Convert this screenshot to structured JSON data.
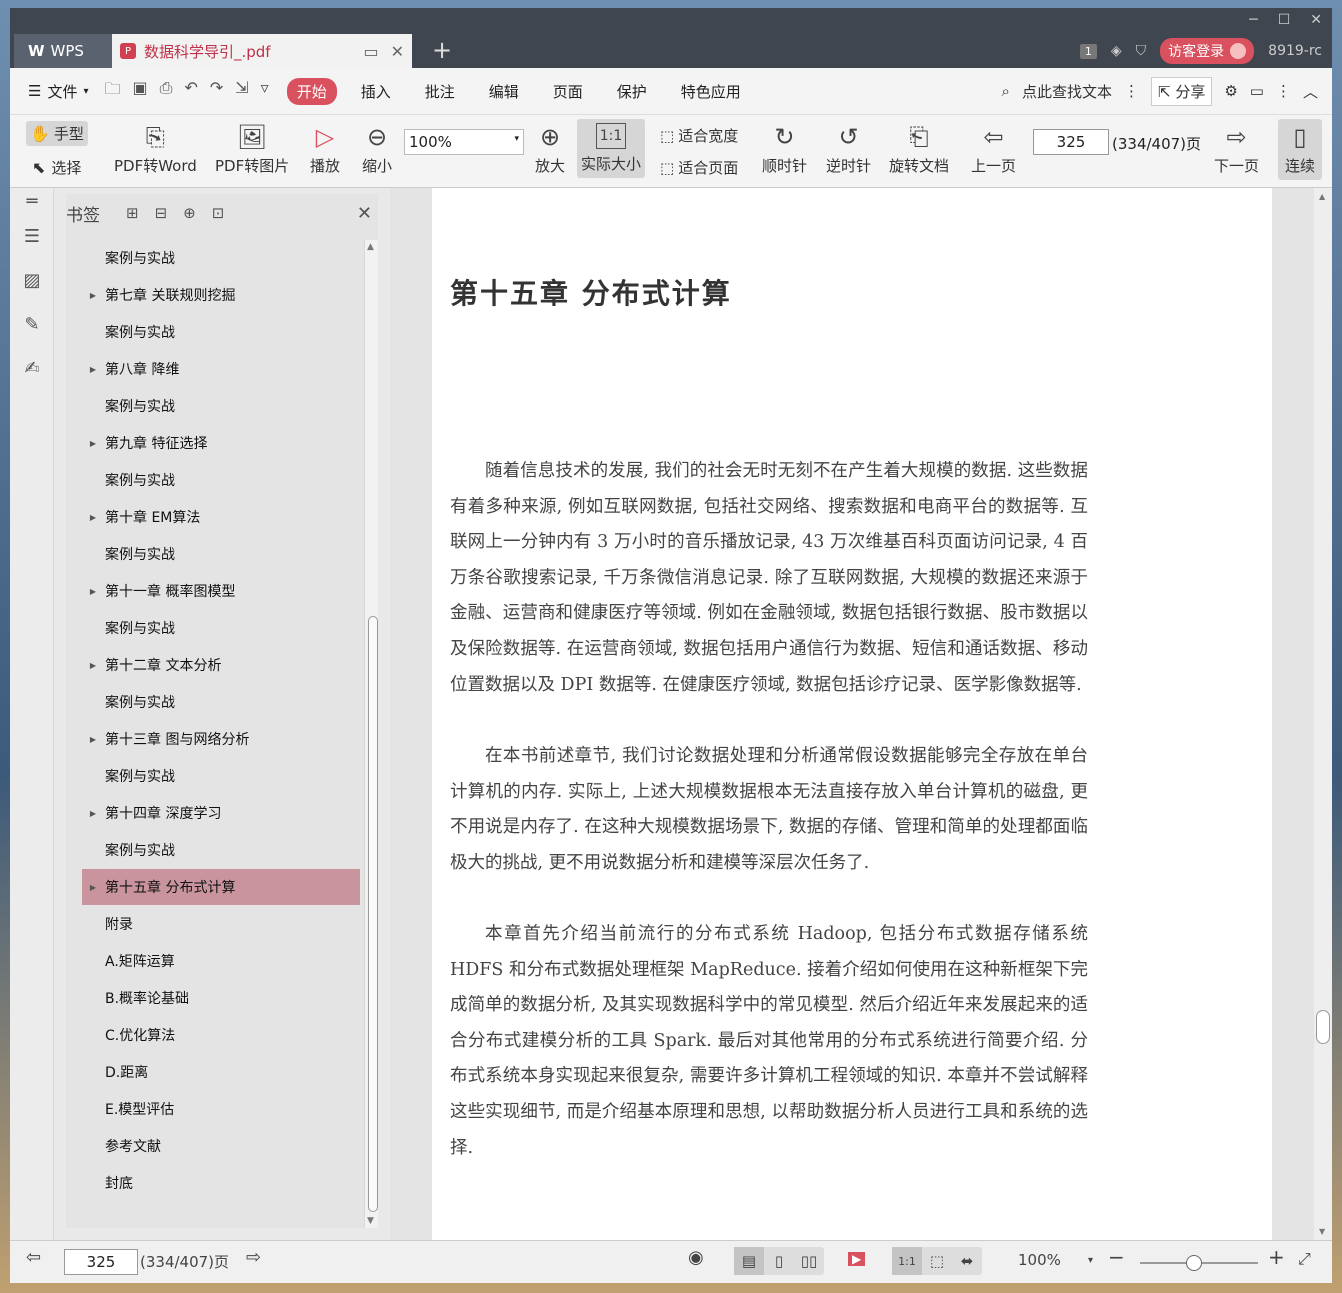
{
  "titlebar": {
    "app_tab": "WPS",
    "doc_tab": "数据科学导引_.pdf",
    "pdf_icon": "P",
    "badge_num": "1",
    "login": "访客登录",
    "user_id": "8919-rc"
  },
  "menubar": {
    "file": "文件",
    "tabs": [
      "开始",
      "插入",
      "批注",
      "编辑",
      "页面",
      "保护",
      "特色应用"
    ],
    "active_tab": "开始",
    "search": "点此查找文本",
    "share": "分享"
  },
  "ribbon": {
    "hand": "手型",
    "select": "选择",
    "pdf2word": "PDF转Word",
    "pdf2img": "PDF转图片",
    "play": "播放",
    "zoom_out": "缩小",
    "zoom_value": "100%",
    "zoom_in": "放大",
    "actual_size": "实际大小",
    "fit_width": "适合宽度",
    "fit_page": "适合页面",
    "clockwise": "顺时针",
    "counter": "逆时针",
    "rotate_doc": "旋转文档",
    "prev": "上一页",
    "page_num": "325",
    "page_total": "(334/407)页",
    "next": "下一页",
    "continuous": "连续"
  },
  "bookmarks": {
    "title": "书签",
    "items": [
      {
        "label": "案例与实战",
        "expandable": false
      },
      {
        "label": "第七章 关联规则挖掘",
        "expandable": true
      },
      {
        "label": "案例与实战",
        "expandable": false
      },
      {
        "label": "第八章 降维",
        "expandable": true
      },
      {
        "label": "案例与实战",
        "expandable": false
      },
      {
        "label": "第九章 特征选择",
        "expandable": true
      },
      {
        "label": "案例与实战",
        "expandable": false
      },
      {
        "label": "第十章 EM算法",
        "expandable": true
      },
      {
        "label": "案例与实战",
        "expandable": false
      },
      {
        "label": "第十一章 概率图模型",
        "expandable": true
      },
      {
        "label": "案例与实战",
        "expandable": false
      },
      {
        "label": "第十二章 文本分析",
        "expandable": true
      },
      {
        "label": "案例与实战",
        "expandable": false
      },
      {
        "label": "第十三章 图与网络分析",
        "expandable": true
      },
      {
        "label": "案例与实战",
        "expandable": false
      },
      {
        "label": "第十四章 深度学习",
        "expandable": true
      },
      {
        "label": "案例与实战",
        "expandable": false
      },
      {
        "label": "第十五章 分布式计算",
        "expandable": true,
        "active": true
      },
      {
        "label": "附录",
        "expandable": false
      },
      {
        "label": "A.矩阵运算",
        "expandable": false
      },
      {
        "label": "B.概率论基础",
        "expandable": false
      },
      {
        "label": "C.优化算法",
        "expandable": false
      },
      {
        "label": "D.距离",
        "expandable": false
      },
      {
        "label": "E.模型评估",
        "expandable": false
      },
      {
        "label": "参考文献",
        "expandable": false
      },
      {
        "label": "封底",
        "expandable": false
      }
    ]
  },
  "document": {
    "chapter_title": "第十五章  分布式计算",
    "paragraphs": [
      "随着信息技术的发展, 我们的社会无时无刻不在产生着大规模的数据. 这些数据有着多种来源, 例如互联网数据, 包括社交网络、搜索数据和电商平台的数据等. 互联网上一分钟内有 3 万小时的音乐播放记录, 43 万次维基百科页面访问记录, 4 百万条谷歌搜索记录, 千万条微信消息记录. 除了互联网数据, 大规模的数据还来源于金融、运营商和健康医疗等领域. 例如在金融领域, 数据包括银行数据、股市数据以及保险数据等. 在运营商领域, 数据包括用户通信行为数据、短信和通话数据、移动位置数据以及 DPI 数据等. 在健康医疗领域, 数据包括诊疗记录、医学影像数据等.",
      "在本书前述章节, 我们讨论数据处理和分析通常假设数据能够完全存放在单台计算机的内存. 实际上, 上述大规模数据根本无法直接存放入单台计算机的磁盘, 更不用说是内存了. 在这种大规模数据场景下, 数据的存储、管理和简单的处理都面临极大的挑战, 更不用说数据分析和建模等深层次任务了.",
      "本章首先介绍当前流行的分布式系统 Hadoop, 包括分布式数据存储系统 HDFS 和分布式数据处理框架 MapReduce. 接着介绍如何使用在这种新框架下完成简单的数据分析, 及其实现数据科学中的常见模型. 然后介绍近年来发展起来的适合分布式建模分析的工具 Spark. 最后对其他常用的分布式系统进行简要介绍. 分布式系统本身实现起来很复杂, 需要许多计算机工程领域的知识. 本章并不尝试解释这些实现细节, 而是介绍基本原理和思想, 以帮助数据分析人员进行工具和系统的选择."
    ]
  },
  "statusbar": {
    "page_num": "325",
    "page_total": "(334/407)页",
    "zoom": "100%"
  },
  "colors": {
    "accent": "#d9505e",
    "bookmark_active": "#c9949e",
    "titlebar": "#404650"
  }
}
